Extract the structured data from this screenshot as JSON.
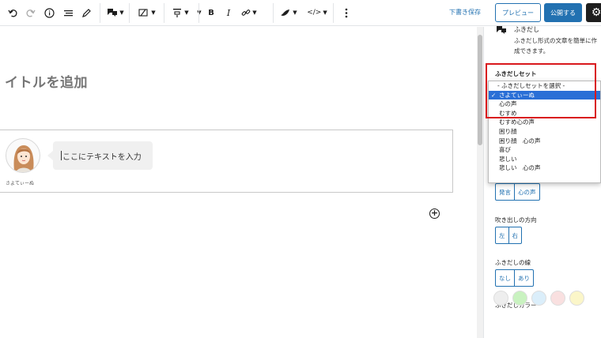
{
  "toolbar": {
    "icons": [
      "undo-icon",
      "redo-icon",
      "info-icon",
      "list-view-icon",
      "pen-icon",
      "balloon-block-icon",
      "align-icon",
      "heading-icon",
      "bold-icon",
      "italic-icon",
      "link-icon",
      "ink-icon",
      "code-icon",
      "more-vertical-icon",
      "gear-icon"
    ],
    "bold_label": "B",
    "italic_label": "I",
    "code_label": "</>",
    "save_draft_label": "下書き保存",
    "preview_label": "プレビュー",
    "publish_label": "公開する"
  },
  "editor": {
    "title_placeholder": "イトルを追加",
    "balloon": {
      "avatar_name": "さよてぃーぬ",
      "text_placeholder": "ここにテキストを入力"
    }
  },
  "sidebar": {
    "block_name": "ふきだし",
    "block_description": "ふきだし形式の文章を簡単に作成できます。",
    "balloon_set_label": "ふきだしセット",
    "balloon_set": {
      "options": [
        "- ふきだしセットを選択 -",
        "さよてぃーぬ",
        "心の声",
        "むすめ",
        "むすめ心の声",
        "困り顔",
        "困り顔　心の声",
        "喜び",
        "悲しい",
        "悲しい　心の声"
      ],
      "selected": "さよてぃーぬ"
    },
    "type_buttons": [
      "発言",
      "心の声"
    ],
    "direction_label": "吹き出しの方向",
    "direction_buttons": [
      "左",
      "右"
    ],
    "border_label": "ふきだしの線",
    "border_buttons": [
      "なし",
      "あり"
    ],
    "color_label": "ふきだしカラー",
    "colors": [
      "#eeeeee",
      "#c9f2c0",
      "#dbeefa",
      "#f9e0e0",
      "#fbf6c9"
    ]
  },
  "accent_color": "#2271b1",
  "highlight_color": "#d9171c"
}
